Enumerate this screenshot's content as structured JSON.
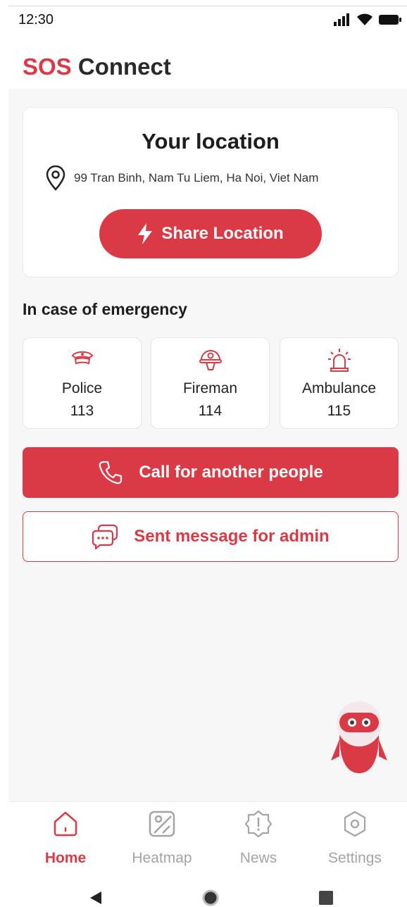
{
  "status": {
    "time": "12:30"
  },
  "brand": {
    "part1": "SOS",
    "part2": "Connect"
  },
  "location": {
    "title": "Your location",
    "address": "99 Tran Binh, Nam Tu Liem, Ha Noi, Viet Nam",
    "share_label": "Share Location"
  },
  "emergency": {
    "title": "In case of emergency",
    "items": [
      {
        "name": "Police",
        "number": "113",
        "icon": "police-cap-icon"
      },
      {
        "name": "Fireman",
        "number": "114",
        "icon": "fireman-helmet-icon"
      },
      {
        "name": "Ambulance",
        "number": "115",
        "icon": "siren-icon"
      }
    ]
  },
  "actions": {
    "call_label": "Call for another people",
    "message_label": "Sent message for admin"
  },
  "nav": {
    "items": [
      {
        "label": "Home",
        "icon": "home-icon",
        "active": true
      },
      {
        "label": "Heatmap",
        "icon": "map-icon",
        "active": false
      },
      {
        "label": "News",
        "icon": "news-alert-icon",
        "active": false
      },
      {
        "label": "Settings",
        "icon": "settings-icon",
        "active": false
      }
    ]
  },
  "colors": {
    "accent": "#d93a45",
    "inactive": "#a3a3a8",
    "background": "#f7f7f8"
  }
}
